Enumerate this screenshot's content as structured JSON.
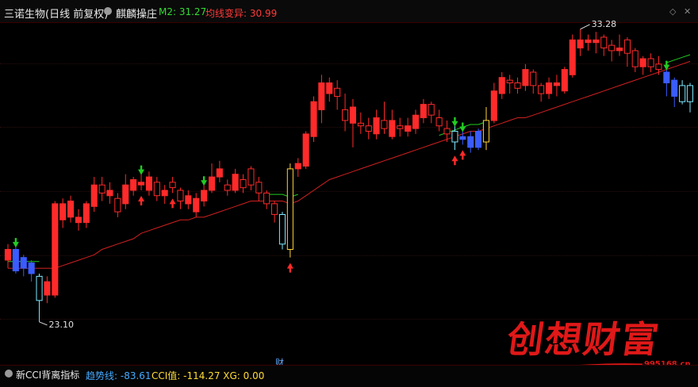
{
  "header": {
    "stock_title": "三诺生物(日线 前复权)",
    "indicator_name": "麒麟操庄",
    "m2_label": "M2: 31.27",
    "avg_label": "均线变异: 30.99",
    "icon_left": "diamond-icon",
    "icon_right": "close-icon"
  },
  "chart_data": {
    "type": "candlestick",
    "title": "三诺生物(日线 前复权)",
    "ylim": [
      21.8,
      34.2
    ],
    "high_label": "33.28",
    "low_label": "23.10",
    "cai_label": "财",
    "candles": [
      {
        "o": 25.4,
        "c": 25.8,
        "h": 26.0,
        "l": 25.1,
        "up": true
      },
      {
        "o": 25.8,
        "c": 25.0,
        "h": 25.9,
        "l": 24.9,
        "up": false
      },
      {
        "o": 25.1,
        "c": 25.5,
        "h": 25.6,
        "l": 24.8,
        "up": true
      },
      {
        "o": 25.3,
        "c": 24.9,
        "h": 25.4,
        "l": 24.6,
        "up": false
      },
      {
        "o": 24.8,
        "c": 23.9,
        "h": 24.9,
        "l": 23.1,
        "up": false
      },
      {
        "o": 24.1,
        "c": 24.6,
        "h": 24.8,
        "l": 23.8,
        "up": true
      },
      {
        "o": 24.1,
        "c": 27.5,
        "h": 27.6,
        "l": 24.0,
        "up": true
      },
      {
        "o": 26.9,
        "c": 27.5,
        "h": 27.7,
        "l": 26.6,
        "up": true
      },
      {
        "o": 27.0,
        "c": 27.6,
        "h": 27.8,
        "l": 26.8,
        "up": true
      },
      {
        "o": 26.8,
        "c": 27.0,
        "h": 27.3,
        "l": 26.5,
        "up": true
      },
      {
        "o": 26.8,
        "c": 27.5,
        "h": 27.6,
        "l": 26.6,
        "up": true
      },
      {
        "o": 27.4,
        "c": 28.2,
        "h": 28.5,
        "l": 27.2,
        "up": true
      },
      {
        "o": 28.2,
        "c": 27.9,
        "h": 28.5,
        "l": 27.6,
        "up": false
      },
      {
        "o": 27.8,
        "c": 28.0,
        "h": 28.3,
        "l": 27.5,
        "up": true
      },
      {
        "o": 27.7,
        "c": 27.2,
        "h": 27.9,
        "l": 27.0,
        "up": false
      },
      {
        "o": 27.5,
        "c": 28.2,
        "h": 28.6,
        "l": 27.3,
        "up": true
      },
      {
        "o": 28.0,
        "c": 28.4,
        "h": 28.5,
        "l": 27.8,
        "up": true
      },
      {
        "o": 28.2,
        "c": 28.3,
        "h": 28.6,
        "l": 28.0,
        "up": true
      },
      {
        "o": 28.0,
        "c": 28.5,
        "h": 28.7,
        "l": 27.8,
        "up": true
      },
      {
        "o": 28.3,
        "c": 27.8,
        "h": 28.5,
        "l": 27.6,
        "up": false
      },
      {
        "o": 27.8,
        "c": 28.0,
        "h": 28.2,
        "l": 27.5,
        "up": true
      },
      {
        "o": 28.3,
        "c": 28.1,
        "h": 28.5,
        "l": 27.9,
        "up": false
      },
      {
        "o": 28.0,
        "c": 27.6,
        "h": 28.1,
        "l": 27.3,
        "up": false
      },
      {
        "o": 27.5,
        "c": 27.8,
        "h": 28.0,
        "l": 27.3,
        "up": true
      },
      {
        "o": 27.2,
        "c": 27.7,
        "h": 27.9,
        "l": 27.0,
        "up": true
      },
      {
        "o": 27.6,
        "c": 28.0,
        "h": 28.2,
        "l": 27.4,
        "up": true
      },
      {
        "o": 28.0,
        "c": 28.5,
        "h": 29.0,
        "l": 27.9,
        "up": true
      },
      {
        "o": 28.5,
        "c": 28.8,
        "h": 29.1,
        "l": 28.3,
        "up": true
      },
      {
        "o": 28.2,
        "c": 28.0,
        "h": 28.4,
        "l": 27.8,
        "up": false
      },
      {
        "o": 28.0,
        "c": 28.6,
        "h": 28.8,
        "l": 27.9,
        "up": true
      },
      {
        "o": 28.4,
        "c": 28.1,
        "h": 28.6,
        "l": 27.9,
        "up": false
      },
      {
        "o": 28.8,
        "c": 28.2,
        "h": 28.9,
        "l": 28.0,
        "up": false
      },
      {
        "o": 28.3,
        "c": 27.9,
        "h": 28.5,
        "l": 27.6,
        "up": false
      },
      {
        "o": 27.9,
        "c": 27.5,
        "h": 28.0,
        "l": 27.3,
        "up": false
      },
      {
        "o": 27.5,
        "c": 27.1,
        "h": 27.6,
        "l": 26.8,
        "up": false
      },
      {
        "o": 27.1,
        "c": 26.0,
        "h": 27.2,
        "l": 25.8,
        "up": false
      },
      {
        "o": 25.8,
        "c": 28.8,
        "h": 29.0,
        "l": 25.5,
        "up": true
      },
      {
        "o": 28.8,
        "c": 29.0,
        "h": 29.2,
        "l": 28.5,
        "up": true
      },
      {
        "o": 28.9,
        "c": 30.1,
        "h": 30.2,
        "l": 28.8,
        "up": true
      },
      {
        "o": 30.0,
        "c": 31.3,
        "h": 31.5,
        "l": 29.8,
        "up": true
      },
      {
        "o": 31.0,
        "c": 32.0,
        "h": 32.3,
        "l": 30.5,
        "up": true
      },
      {
        "o": 31.6,
        "c": 32.0,
        "h": 32.2,
        "l": 31.3,
        "up": true
      },
      {
        "o": 31.8,
        "c": 31.5,
        "h": 32.1,
        "l": 31.0,
        "up": false
      },
      {
        "o": 31.0,
        "c": 30.6,
        "h": 31.6,
        "l": 30.2,
        "up": false
      },
      {
        "o": 30.5,
        "c": 31.1,
        "h": 31.4,
        "l": 29.6,
        "up": true
      },
      {
        "o": 30.5,
        "c": 30.4,
        "h": 30.9,
        "l": 30.1,
        "up": false
      },
      {
        "o": 30.4,
        "c": 30.2,
        "h": 30.7,
        "l": 29.9,
        "up": false
      },
      {
        "o": 30.1,
        "c": 30.7,
        "h": 31.0,
        "l": 29.9,
        "up": true
      },
      {
        "o": 30.6,
        "c": 30.3,
        "h": 31.3,
        "l": 30.1,
        "up": false
      },
      {
        "o": 30.0,
        "c": 30.6,
        "h": 31.0,
        "l": 29.9,
        "up": true
      },
      {
        "o": 30.4,
        "c": 30.3,
        "h": 30.7,
        "l": 30.0,
        "up": false
      },
      {
        "o": 30.2,
        "c": 30.4,
        "h": 30.7,
        "l": 30.0,
        "up": true
      },
      {
        "o": 30.3,
        "c": 30.8,
        "h": 31.0,
        "l": 30.1,
        "up": true
      },
      {
        "o": 30.7,
        "c": 31.2,
        "h": 31.4,
        "l": 30.5,
        "up": true
      },
      {
        "o": 31.2,
        "c": 30.8,
        "h": 31.3,
        "l": 30.5,
        "up": false
      },
      {
        "o": 30.7,
        "c": 30.4,
        "h": 31.0,
        "l": 30.2,
        "up": false
      },
      {
        "o": 30.3,
        "c": 30.1,
        "h": 30.6,
        "l": 29.8,
        "up": false
      },
      {
        "o": 30.2,
        "c": 29.8,
        "h": 30.4,
        "l": 29.5,
        "up": false
      },
      {
        "o": 30.0,
        "c": 29.9,
        "h": 30.2,
        "l": 29.7,
        "up": false
      },
      {
        "o": 30.0,
        "c": 29.6,
        "h": 30.2,
        "l": 29.4,
        "up": false
      },
      {
        "o": 29.6,
        "c": 30.2,
        "h": 30.3,
        "l": 29.5,
        "up": true
      },
      {
        "o": 29.8,
        "c": 30.6,
        "h": 31.1,
        "l": 29.5,
        "up": true
      },
      {
        "o": 30.6,
        "c": 31.7,
        "h": 32.0,
        "l": 30.5,
        "up": true
      },
      {
        "o": 31.6,
        "c": 32.2,
        "h": 32.4,
        "l": 31.4,
        "up": true
      },
      {
        "o": 32.1,
        "c": 32.0,
        "h": 32.3,
        "l": 31.6,
        "up": false
      },
      {
        "o": 32.0,
        "c": 31.8,
        "h": 32.2,
        "l": 31.6,
        "up": false
      },
      {
        "o": 31.9,
        "c": 32.5,
        "h": 32.7,
        "l": 31.7,
        "up": true
      },
      {
        "o": 32.4,
        "c": 31.9,
        "h": 32.5,
        "l": 31.6,
        "up": false
      },
      {
        "o": 31.9,
        "c": 31.6,
        "h": 32.0,
        "l": 31.3,
        "up": false
      },
      {
        "o": 31.6,
        "c": 32.0,
        "h": 32.2,
        "l": 31.4,
        "up": true
      },
      {
        "o": 31.9,
        "c": 32.0,
        "h": 32.3,
        "l": 31.5,
        "up": true
      },
      {
        "o": 31.7,
        "c": 32.5,
        "h": 32.6,
        "l": 31.6,
        "up": true
      },
      {
        "o": 32.3,
        "c": 33.6,
        "h": 33.8,
        "l": 32.2,
        "up": true
      },
      {
        "o": 33.3,
        "c": 33.6,
        "h": 34.0,
        "l": 33.0,
        "up": true
      },
      {
        "o": 33.5,
        "c": 33.6,
        "h": 33.8,
        "l": 33.2,
        "up": true
      },
      {
        "o": 33.5,
        "c": 33.6,
        "h": 33.9,
        "l": 33.1,
        "up": true
      },
      {
        "o": 33.7,
        "c": 33.3,
        "h": 33.8,
        "l": 33.0,
        "up": false
      },
      {
        "o": 33.4,
        "c": 33.2,
        "h": 33.6,
        "l": 32.8,
        "up": false
      },
      {
        "o": 33.3,
        "c": 33.2,
        "h": 33.8,
        "l": 33.0,
        "up": true
      },
      {
        "o": 33.6,
        "c": 33.1,
        "h": 33.7,
        "l": 32.6,
        "up": false
      },
      {
        "o": 33.2,
        "c": 32.6,
        "h": 33.3,
        "l": 32.4,
        "up": false
      },
      {
        "o": 32.6,
        "c": 32.9,
        "h": 33.0,
        "l": 32.3,
        "up": true
      },
      {
        "o": 32.9,
        "c": 32.6,
        "h": 33.1,
        "l": 32.4,
        "up": false
      },
      {
        "o": 32.7,
        "c": 32.5,
        "h": 33.0,
        "l": 32.3,
        "up": false
      },
      {
        "o": 32.4,
        "c": 32.0,
        "h": 32.5,
        "l": 31.5,
        "up": false
      },
      {
        "o": 32.1,
        "c": 31.5,
        "h": 32.2,
        "l": 31.1,
        "up": false
      },
      {
        "o": 31.3,
        "c": 31.9,
        "h": 32.1,
        "l": 31.2,
        "up": true
      },
      {
        "o": 31.9,
        "c": 31.3,
        "h": 32.0,
        "l": 30.9,
        "up": false
      }
    ],
    "ma_line": [
      25.1,
      25.1,
      25.1,
      25.1,
      25.1,
      25.1,
      25.1,
      25.2,
      25.3,
      25.4,
      25.5,
      25.6,
      25.8,
      25.9,
      26.0,
      26.1,
      26.2,
      26.4,
      26.5,
      26.6,
      26.7,
      26.8,
      26.9,
      26.9,
      27.0,
      27.0,
      27.1,
      27.2,
      27.3,
      27.4,
      27.5,
      27.6,
      27.6,
      27.6,
      27.6,
      27.6,
      27.5,
      27.6,
      27.8,
      28.0,
      28.2,
      28.4,
      28.5,
      28.6,
      28.7,
      28.8,
      28.9,
      29.0,
      29.1,
      29.2,
      29.3,
      29.4,
      29.5,
      29.6,
      29.7,
      29.8,
      29.9,
      30.0,
      30.1,
      30.2,
      30.2,
      30.3,
      30.4,
      30.5,
      30.6,
      30.7,
      30.7,
      30.8,
      30.9,
      31.0,
      31.1,
      31.2,
      31.3,
      31.4,
      31.5,
      31.6,
      31.7,
      31.8,
      31.9,
      32.0,
      32.1,
      32.2,
      32.3,
      32.4,
      32.5,
      32.6,
      32.7,
      32.8
    ],
    "blue_candles": [
      1,
      2,
      3,
      4,
      35,
      36,
      57,
      58,
      59,
      60,
      84,
      85,
      86,
      87
    ],
    "highlight_candles": [
      4,
      35,
      57,
      86,
      87
    ],
    "gold_candles": [
      36,
      61
    ],
    "buy_markers": [
      17,
      21,
      36,
      57,
      58
    ],
    "sell_markers": [
      1,
      17,
      25,
      57,
      58,
      84
    ]
  },
  "sub_panel": {
    "title": "新CCI背离指标",
    "trend": "趋势线: -83.61",
    "values": "CCI值: -114.27  XG: 0.00"
  },
  "watermark": {
    "text": "创想财富",
    "url": "995168.cn"
  }
}
